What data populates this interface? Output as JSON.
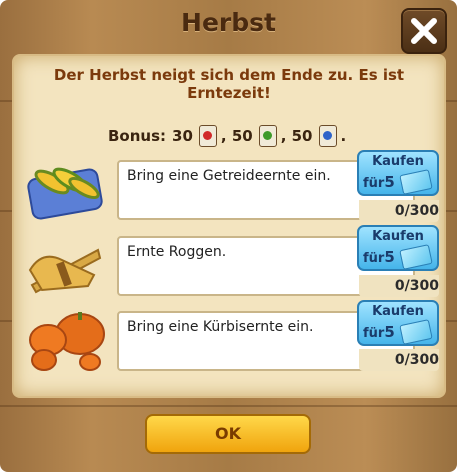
{
  "dialog": {
    "title": "Herbst",
    "subtitle": "Der Herbst neigt sich dem Ende zu. Es ist Erntezeit!",
    "close_icon": "close-x-icon"
  },
  "bonus": {
    "label": "Bonus:",
    "items": [
      {
        "amount": "30",
        "icon": "seed-bag-red-icon"
      },
      {
        "amount": ", 50",
        "icon": "seed-bag-green-icon"
      },
      {
        "amount": ", 50",
        "icon": "seed-bag-blue-icon"
      }
    ],
    "end": "."
  },
  "quests": [
    {
      "icon": "corn-dish-icon",
      "text": "Bring eine Getreideernte ein.",
      "buy_label": "Kaufen",
      "buy_for": "für",
      "buy_price": "5",
      "progress": "0/300"
    },
    {
      "icon": "rye-bundle-icon",
      "text": "Ernte Roggen.",
      "buy_label": "Kaufen",
      "buy_for": "für",
      "buy_price": "5",
      "progress": "0/300"
    },
    {
      "icon": "pumpkins-icon",
      "text": "Bring eine Kürbisernte ein.",
      "buy_label": "Kaufen",
      "buy_for": "für",
      "buy_price": "5",
      "progress": "0/300"
    }
  ],
  "ok_label": "OK",
  "colors": {
    "accent_blue": "#45b4ea",
    "ok_yellow": "#ffd84a",
    "title_brown": "#4a2a10",
    "subtitle_brown": "#7b3a0c"
  }
}
